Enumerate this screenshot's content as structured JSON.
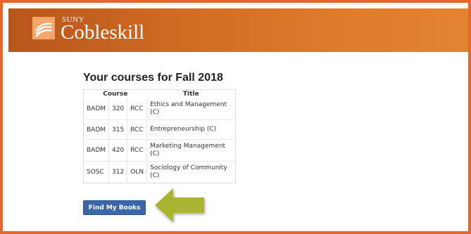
{
  "header": {
    "brand_small": "SUNY",
    "brand_large": "Cobleskill",
    "colors": {
      "frame": "#e8662d",
      "header_start": "#b8561c",
      "header_end": "#e48432"
    },
    "logo_icon": "suny-cobleskill-logo-icon"
  },
  "main": {
    "title": "Your courses for Fall 2018",
    "table": {
      "headers": [
        "Course",
        "Title"
      ],
      "rows": [
        {
          "dept": "BADM",
          "num": "320",
          "section": "RCC",
          "title": "Ethics and Management (C)"
        },
        {
          "dept": "BADM",
          "num": "315",
          "section": "RCC",
          "title": "Entrepreneurship (C)"
        },
        {
          "dept": "BADM",
          "num": "420",
          "section": "RCC",
          "title": "Marketing Management (C)"
        },
        {
          "dept": "SOSC",
          "num": "312",
          "section": "OLN",
          "title": "Sociology of Community (C)"
        }
      ]
    },
    "find_button": {
      "label": "Find My Books",
      "color": "#3a67a8"
    },
    "arrow": {
      "icon": "left-arrow-icon",
      "color": "#a9b530"
    }
  }
}
